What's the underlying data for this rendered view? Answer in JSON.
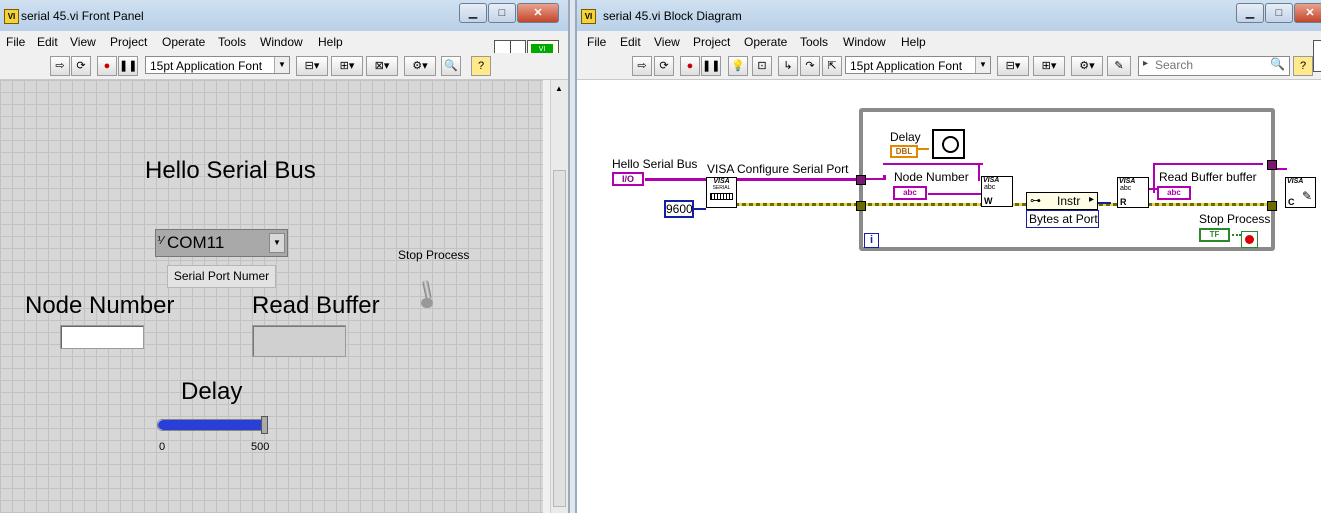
{
  "front_panel": {
    "title": "serial 45.vi Front Panel",
    "menu": [
      "File",
      "Edit",
      "View",
      "Project",
      "Operate",
      "Tools",
      "Window",
      "Help"
    ],
    "font": "15pt Application Font",
    "heading": "Hello Serial Bus",
    "com_prefix": "⅟",
    "com_value": "COM11",
    "com_caption": "Serial Port Numer",
    "stop_label": "Stop Process",
    "node_label": "Node Number",
    "read_label": "Read Buffer",
    "delay_label": "Delay",
    "slider_min": "0",
    "slider_max": "500",
    "slider_value_fraction": 1.0
  },
  "block_diagram": {
    "title": "serial 45.vi Block Diagram",
    "menu": [
      "File",
      "Edit",
      "View",
      "Project",
      "Operate",
      "Tools",
      "Window",
      "Help"
    ],
    "font": "15pt Application Font",
    "search_placeholder": "Search",
    "hello_label": "Hello Serial Bus",
    "io_tag": "I/O",
    "visa_configure_label": "VISA Configure Serial Port",
    "baud_value": "9600",
    "delay_label": "Delay",
    "dbl_tag": "DBL",
    "node_label": "Node Number",
    "abc_tag": "abc",
    "instr_label": "Instr",
    "bytes_label": "Bytes at Port",
    "read_buffer_label": "Read Buffer buffer",
    "stop_label": "Stop Process",
    "tf_tag": "TF",
    "loop_index": "i",
    "visa_tag": "VISA",
    "serial_tag": "SERIAL",
    "w_tag": "W",
    "r_tag": "R",
    "c_tag": "C"
  },
  "colors": {
    "wire_pink": "#b000b0",
    "wire_olive": "#6b6b00",
    "loop_gray": "#8a8a8a",
    "slider_blue": "#2840d8",
    "int_blue": "#1420a0",
    "bool_green": "#2a8a2a",
    "dbl_orange": "#e08a00"
  }
}
